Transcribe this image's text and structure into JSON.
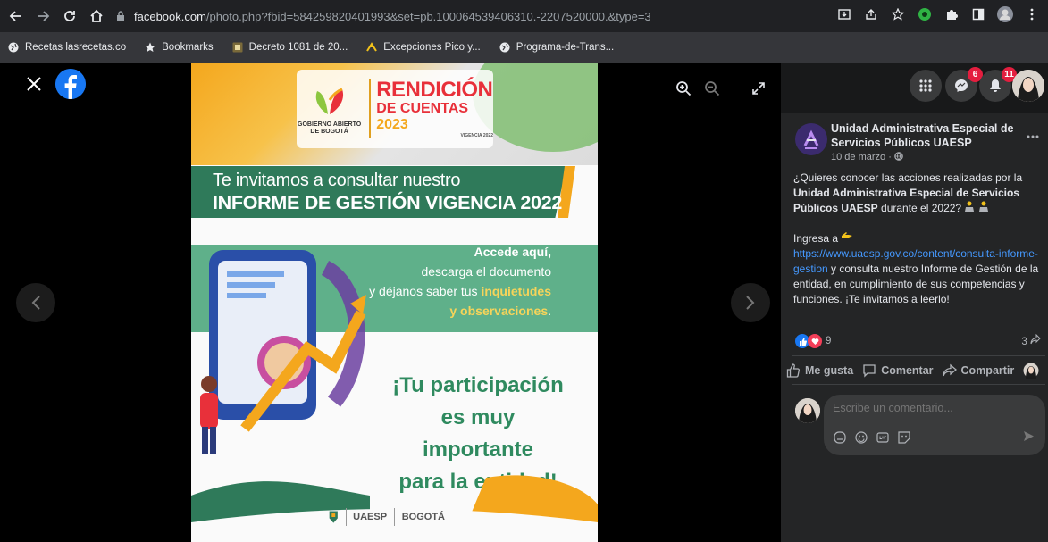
{
  "browser": {
    "url_host": "facebook.com",
    "url_path": "/photo.php?fbid=584259820401993&set=pb.100064539406310.-2207520000.&type=3",
    "bookmarks": [
      {
        "label": "Recetas lasrecetas.co",
        "icon": "globe-icon"
      },
      {
        "label": "Bookmarks",
        "icon": "star-icon"
      },
      {
        "label": "Decreto 1081 de 20...",
        "icon": "doc-icon"
      },
      {
        "label": "Excepciones Pico y...",
        "icon": "yellow-mark-icon"
      },
      {
        "label": "Programa-de-Trans...",
        "icon": "globe-icon"
      }
    ]
  },
  "poster": {
    "gob_label": "GOBIERNO ABIERTO DE BOGOTÁ",
    "rendicion_1": "RENDICIÓN",
    "rendicion_2": "DE CUENTAS",
    "rendicion_year": "2023",
    "vigencia": "VIGENCIA 2022",
    "title_line1": "Te invitamos a consultar nuestro",
    "title_line2": "INFORME DE GESTIÓN VIGENCIA 2022",
    "mid_line1": "Accede aquí,",
    "mid_line2": "descarga el documento",
    "mid_line3a": "y déjanos saber tus ",
    "mid_line3b": "inquietudes",
    "mid_line4": "y observaciones",
    "mid_line4_end": ".",
    "cta_line1": "¡Tu participación",
    "cta_line2": "es muy importante",
    "cta_line3": "para la entidad!",
    "footer_logo_1": "UAESP",
    "footer_logo_2": "BOGOTÁ"
  },
  "sidebar": {
    "messenger_badge": "6",
    "notif_badge": "11",
    "page_name": "Unidad Administrativa Especial de Servicios Públicos UAESP",
    "post_date": "10 de marzo ·",
    "text_p1_a": "¿Quieres conocer las acciones realizadas por la ",
    "text_p1_b": "Unidad Administrativa Especial de Servicios Públicos UAESP",
    "text_p1_c": " durante el 2022? ",
    "text_p2_a": "Ingresa a ",
    "link": "https://www.uaesp.gov.co/content/consulta-informe-gestion",
    "text_p2_b": " y consulta nuestro Informe de Gestión de la entidad, en cumplimiento de sus competencias y funciones. ¡Te invitamos a leerlo!",
    "reactions_count": "9",
    "shares_count": "3",
    "like_label": "Me gusta",
    "comment_label": "Comentar",
    "share_label": "Compartir",
    "comment_placeholder": "Escribe un comentario..."
  },
  "colors": {
    "fb_blue": "#1877f2",
    "link": "#4599ff",
    "poster_green": "#2f7a5a",
    "poster_orange": "#f4a71d",
    "badge_red": "#e41e3f"
  }
}
